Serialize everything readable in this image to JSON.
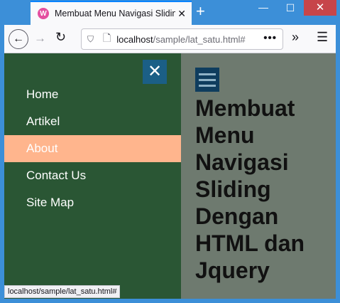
{
  "browser": {
    "tab_title": "Membuat Menu Navigasi Sliding Dengan HTML dan Jquery",
    "favicon_letter": "W",
    "url_host": "localhost",
    "url_path": "/sample/lat_satu.html#",
    "url_more": "•••",
    "status_url": "localhost/sample/lat_satu.html#"
  },
  "sidenav": {
    "close_glyph": "✕",
    "items": [
      {
        "label": "Home",
        "active": false
      },
      {
        "label": "Artikel",
        "active": false
      },
      {
        "label": "About",
        "active": true
      },
      {
        "label": "Contact Us",
        "active": false
      },
      {
        "label": "Site Map",
        "active": false
      }
    ]
  },
  "main": {
    "heading": "Membuat Menu Navigasi Sliding Dengan HTML dan Jquery"
  },
  "colors": {
    "sidenav_bg": "#2a5634",
    "active_item": "#ffb58d",
    "close_button": "#1b5f86",
    "main_bg": "#6e7a6f"
  }
}
